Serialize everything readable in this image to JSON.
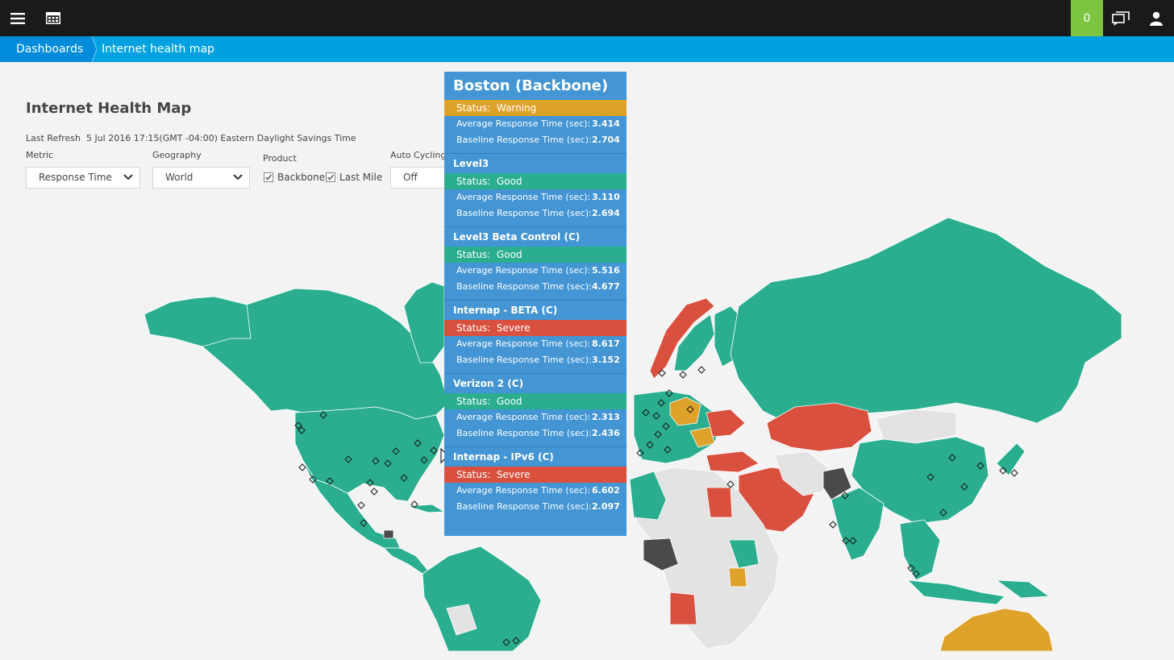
{
  "topbar": {
    "menu_icon": "hamburger-menu-icon",
    "dashboard_icon": "dashboard-grid-icon",
    "notification_count": "0",
    "chat_icon": "chat-icon",
    "user_icon": "user-icon",
    "colors": {
      "bar": "#1a1a1a",
      "notification": "#7dc540"
    }
  },
  "breadcrumb": {
    "root": "Dashboards",
    "current": "Internet health map"
  },
  "page": {
    "title": "Internet Health Map",
    "last_refresh_label": "Last Refresh",
    "last_refresh_value": "5 Jul 2016 17:15(GMT -04:00) Eastern Daylight Savings Time"
  },
  "filters": {
    "metric": {
      "label": "Metric",
      "value": "Response Time"
    },
    "geography": {
      "label": "Geography",
      "value": "World"
    },
    "product": {
      "label": "Product",
      "options": [
        {
          "label": "Backbone",
          "checked": true
        },
        {
          "label": "Last Mile",
          "checked": true
        }
      ]
    },
    "auto_cycling": {
      "label": "Auto Cycling",
      "value": "Off"
    }
  },
  "status_colors": {
    "Good": "#2aae8f",
    "Warning": "#dea22a",
    "Severe": "#d9503f",
    "NoData": "#e3e3e3",
    "Dark": "#4a4a4a"
  },
  "tooltip": {
    "title": "Boston (Backbone)",
    "status_label": "Status:",
    "avg_label": "Average Response Time (sec):",
    "base_label": "Baseline Response Time (sec):",
    "providers": [
      {
        "name": "Level3",
        "status": "Good",
        "avg": "3.110",
        "base": "2.694"
      },
      {
        "name": "Level3 Beta Control (C)",
        "status": "Good",
        "avg": "5.516",
        "base": "4.677"
      },
      {
        "name": "Internap - BETA (C)",
        "status": "Severe",
        "avg": "8.617",
        "base": "3.152"
      },
      {
        "name": "Verizon 2 (C)",
        "status": "Good",
        "avg": "2.313",
        "base": "2.436"
      },
      {
        "name": "Internap - IPv6 (C)",
        "status": "Severe",
        "avg": "6.602",
        "base": "2.097"
      }
    ],
    "header_status": "Warning",
    "header_avg": "3.414",
    "header_base": "2.704"
  }
}
